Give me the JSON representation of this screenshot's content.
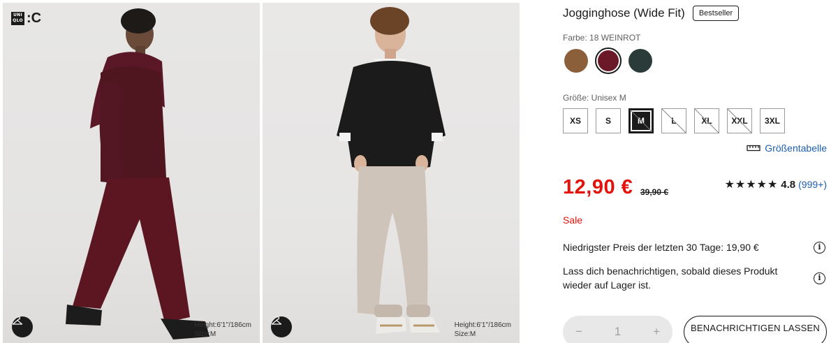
{
  "gallery": {
    "logo": {
      "line1": "UNI",
      "line2": "QLO",
      "suffix": ":C"
    },
    "images": [
      {
        "height_text": "Height:6'1''/186cm",
        "size_text": "Size:M"
      },
      {
        "height_text": "Height:6'1''/186cm",
        "size_text": "Size:M"
      }
    ],
    "icon": "hanger-icon"
  },
  "product": {
    "title": "Jogginghose (Wide Fit)",
    "badge": "Bestseller",
    "color_label": "Farbe: 18 WEINROT",
    "colors": [
      {
        "name": "brown",
        "hex": "#8a5f3a",
        "selected": false
      },
      {
        "name": "wine-red",
        "hex": "#6b1828",
        "selected": true
      },
      {
        "name": "dark-green",
        "hex": "#2b3b3a",
        "selected": false
      }
    ],
    "size_label": "Größe: Unisex M",
    "sizes": [
      {
        "label": "XS",
        "selected": false,
        "available": true
      },
      {
        "label": "S",
        "selected": false,
        "available": true
      },
      {
        "label": "M",
        "selected": true,
        "available": false
      },
      {
        "label": "L",
        "selected": false,
        "available": false
      },
      {
        "label": "XL",
        "selected": false,
        "available": false
      },
      {
        "label": "XXL",
        "selected": false,
        "available": false
      },
      {
        "label": "3XL",
        "selected": false,
        "available": true
      }
    ],
    "size_chart_label": "Größentabelle",
    "price": "12,90 €",
    "old_price": "39,90 €",
    "stars": "★★★★★",
    "rating": "4.8",
    "rating_count": "(999+)",
    "sale_label": "Sale",
    "lowest_price_text": "Niedrigster Preis der letzten 30 Tage: 19,90 €",
    "notify_text": "Lass dich benachrichtigen, sobald dieses Produkt wieder auf Lager ist.",
    "quantity": {
      "minus": "−",
      "value": "1",
      "plus": "+"
    },
    "notify_button": "BENACHRICHTIGEN LASSEN",
    "info_icon_glyph": "i"
  },
  "colors": {
    "sale_red": "#e3120b",
    "link_blue": "#1c5fb0",
    "text": "#1b1b1b"
  }
}
